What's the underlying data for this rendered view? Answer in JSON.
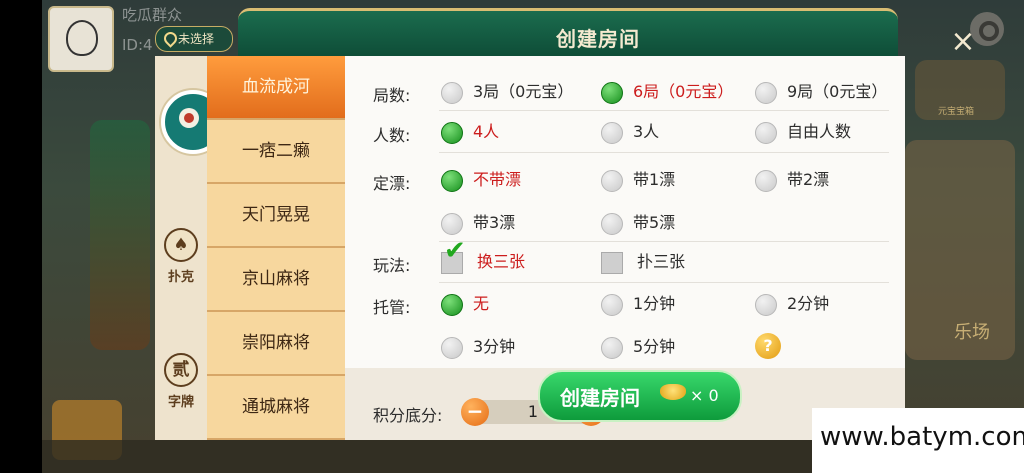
{
  "background": {
    "nickname": "吃瓜群众",
    "user_id": "ID:4",
    "right_text": "元宝宝箱",
    "right_big": "乐场"
  },
  "header": {
    "location": "未选择",
    "title": "创建房间",
    "close": "×"
  },
  "categories": [
    {
      "label": "扑克",
      "icon": "spade-icon"
    },
    {
      "label": "字牌",
      "icon": "zipai-icon",
      "glyph": "贰"
    }
  ],
  "tabs": [
    "血流成河",
    "一痞二癞",
    "天门晃晃",
    "京山麻将",
    "崇阳麻将",
    "通城麻将"
  ],
  "active_tab": "血流成河",
  "settings": {
    "rounds": {
      "label": "局数:",
      "options": [
        "3局（0元宝）",
        "6局（0元宝）",
        "9局（0元宝）"
      ],
      "selected": "6局（0元宝）"
    },
    "players": {
      "label": "人数:",
      "options": [
        "4人",
        "3人",
        "自由人数"
      ],
      "selected": "4人"
    },
    "piao": {
      "label": "定漂:",
      "options": [
        "不带漂",
        "带1漂",
        "带2漂",
        "带3漂",
        "带5漂"
      ],
      "selected": "不带漂"
    },
    "play": {
      "label": "玩法:",
      "options": [
        "换三张",
        "扑三张"
      ],
      "selected": "换三张"
    },
    "trustee": {
      "label": "托管:",
      "options": [
        "无",
        "1分钟",
        "2分钟",
        "3分钟",
        "5分钟"
      ],
      "selected": "无",
      "help": "?"
    }
  },
  "score": {
    "label": "积分底分:",
    "value": "1",
    "minus": "−",
    "plus": "+"
  },
  "create_button": {
    "label": "创建房间",
    "count": "× 0"
  },
  "watermark": "www.batym.com",
  "colors": {
    "accent_orange": "#e26d1c",
    "selected_green": "#168f1d",
    "selected_text": "#cc1d1d",
    "header_green": "#0d4a35"
  }
}
